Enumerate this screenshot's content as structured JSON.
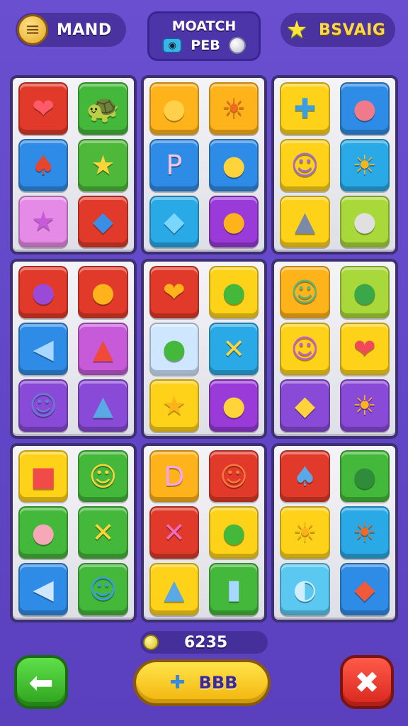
{
  "header": {
    "left": {
      "label": "MAND",
      "icon": "gold-barrel-icon"
    },
    "center": {
      "line1": "MOATCH",
      "line2": "PEB",
      "icons": [
        "gamepad-icon",
        "ball-icon"
      ]
    },
    "right": {
      "label": "BSVAIG",
      "icon": "star-icon"
    }
  },
  "board": {
    "blocks": [
      {
        "tiles": [
          {
            "icon": "heart-icon",
            "glyph": "❤",
            "color": "#e23a2a",
            "fg": "#ff5a6a"
          },
          {
            "icon": "turtle-icon",
            "glyph": "🐢",
            "color": "#43b83a",
            "fg": "#2f7a24"
          },
          {
            "icon": "drumstick-icon",
            "glyph": "♠",
            "color": "#2f8ce6",
            "fg": "#e8452f"
          },
          {
            "icon": "star-icon",
            "glyph": "★",
            "color": "#4db83a",
            "fg": "#ffd43a"
          },
          {
            "icon": "star-icon",
            "glyph": "★",
            "color": "#e58ae6",
            "fg": "#c65ad8"
          },
          {
            "icon": "fish-icon",
            "glyph": "◆",
            "color": "#e23a2a",
            "fg": "#3a8ee6"
          }
        ]
      },
      {
        "tiles": [
          {
            "icon": "bubble-icon",
            "glyph": "●",
            "color": "#ffb31a",
            "fg": "#ffd04a"
          },
          {
            "icon": "sun-icon",
            "glyph": "☀",
            "color": "#ffb31a",
            "fg": "#f06a20"
          },
          {
            "icon": "p-letter-icon",
            "glyph": "P",
            "color": "#2f8ce6",
            "fg": "#f3c6e8"
          },
          {
            "icon": "bird-icon",
            "glyph": "●",
            "color": "#2f8ce6",
            "fg": "#ffd43a"
          },
          {
            "icon": "tag-icon",
            "glyph": "◆",
            "color": "#29a9e6",
            "fg": "#7bd6ff"
          },
          {
            "icon": "balloon-icon",
            "glyph": "●",
            "color": "#9a3ad8",
            "fg": "#ffb31a"
          }
        ]
      },
      {
        "tiles": [
          {
            "icon": "arrow-cross-icon",
            "glyph": "✚",
            "color": "#ffd21a",
            "fg": "#3a9ee6"
          },
          {
            "icon": "speech-bubble-icon",
            "glyph": "●",
            "color": "#2f8ce6",
            "fg": "#f07a8a"
          },
          {
            "icon": "face-icon",
            "glyph": "☺",
            "color": "#ffd21a",
            "fg": "#a06ad8"
          },
          {
            "icon": "sun-face-icon",
            "glyph": "☀",
            "color": "#29a9e6",
            "fg": "#ffb31a"
          },
          {
            "icon": "rocket-icon",
            "glyph": "▲",
            "color": "#ffd21a",
            "fg": "#7a8aa8"
          },
          {
            "icon": "bulb-icon",
            "glyph": "●",
            "color": "#a8d83a",
            "fg": "#e0e0e0"
          }
        ]
      },
      {
        "tiles": [
          {
            "icon": "seal-icon",
            "glyph": "●",
            "color": "#e23a2a",
            "fg": "#9a4ad8"
          },
          {
            "icon": "egg-icon",
            "glyph": "●",
            "color": "#e23a2a",
            "fg": "#ffb31a"
          },
          {
            "icon": "fish-icon",
            "glyph": "◀",
            "color": "#2f8ce6",
            "fg": "#a8d8ff"
          },
          {
            "icon": "cone-icon",
            "glyph": "▲",
            "color": "#c65ad8",
            "fg": "#f04a3a"
          },
          {
            "icon": "cat-icon",
            "glyph": "☺",
            "color": "#8a4ad8",
            "fg": "#6a7ad8"
          },
          {
            "icon": "rocket-icon",
            "glyph": "▲",
            "color": "#8a4ad8",
            "fg": "#5aa8e6"
          }
        ]
      },
      {
        "tiles": [
          {
            "icon": "heart-icon",
            "glyph": "❤",
            "color": "#e23a2a",
            "fg": "#ffb31a"
          },
          {
            "icon": "balloon-icon",
            "glyph": "●",
            "color": "#ffd21a",
            "fg": "#43b83a"
          },
          {
            "icon": "tree-icon",
            "glyph": "●",
            "color": "#cfe6ff",
            "fg": "#43b83a"
          },
          {
            "icon": "x-mark-icon",
            "glyph": "✕",
            "color": "#29a9e6",
            "fg": "#ffd43a"
          },
          {
            "icon": "star-icon",
            "glyph": "★",
            "color": "#ffd21a",
            "fg": "#ffb31a"
          },
          {
            "icon": "balloon-icon",
            "glyph": "●",
            "color": "#9a3ad8",
            "fg": "#ffd43a"
          }
        ]
      },
      {
        "tiles": [
          {
            "icon": "frog-icon",
            "glyph": "☺",
            "color": "#ffb31a",
            "fg": "#5ab87a"
          },
          {
            "icon": "balloon-icon",
            "glyph": "●",
            "color": "#a8d83a",
            "fg": "#3aa84a"
          },
          {
            "icon": "face-icon",
            "glyph": "☺",
            "color": "#ffd21a",
            "fg": "#c65ad8"
          },
          {
            "icon": "heart-icon",
            "glyph": "❤",
            "color": "#ffd21a",
            "fg": "#f04a5a"
          },
          {
            "icon": "bird-icon",
            "glyph": "◆",
            "color": "#8a4ad8",
            "fg": "#ffd43a"
          },
          {
            "icon": "sun-icon",
            "glyph": "☀",
            "color": "#8a4ad8",
            "fg": "#ffb31a"
          }
        ]
      },
      {
        "tiles": [
          {
            "icon": "bag-icon",
            "glyph": "■",
            "color": "#ffd21a",
            "fg": "#f04a4a"
          },
          {
            "icon": "chick-icon",
            "glyph": "☺",
            "color": "#43b83a",
            "fg": "#ffd43a"
          },
          {
            "icon": "pig-icon",
            "glyph": "●",
            "color": "#43b83a",
            "fg": "#f7a8b8"
          },
          {
            "icon": "x-mark-icon",
            "glyph": "✕",
            "color": "#43b83a",
            "fg": "#ffd43a"
          },
          {
            "icon": "fish-icon",
            "glyph": "◀",
            "color": "#2f8ce6",
            "fg": "#cfe6ff"
          },
          {
            "icon": "smiley-icon",
            "glyph": "☺",
            "color": "#43b83a",
            "fg": "#3a9ee6"
          }
        ]
      },
      {
        "tiles": [
          {
            "icon": "d-letter-icon",
            "glyph": "D",
            "color": "#ffb31a",
            "fg": "#f3a6e8"
          },
          {
            "icon": "monster-icon",
            "glyph": "☺",
            "color": "#e23a2a",
            "fg": "#ff7a3a"
          },
          {
            "icon": "x-mark-icon",
            "glyph": "✕",
            "color": "#e23a2a",
            "fg": "#f06ab8"
          },
          {
            "icon": "balloon-icon",
            "glyph": "●",
            "color": "#ffd21a",
            "fg": "#43b83a"
          },
          {
            "icon": "rocket-icon",
            "glyph": "▲",
            "color": "#ffd21a",
            "fg": "#5aa8e6"
          },
          {
            "icon": "clipboard-icon",
            "glyph": "▮",
            "color": "#43b83a",
            "fg": "#a8d8ff"
          }
        ]
      },
      {
        "tiles": [
          {
            "icon": "drumstick-icon",
            "glyph": "♠",
            "color": "#e23a2a",
            "fg": "#5aa8e6"
          },
          {
            "icon": "balloon-icon",
            "glyph": "●",
            "color": "#43b83a",
            "fg": "#2f8c3a"
          },
          {
            "icon": "bug-icon",
            "glyph": "☀",
            "color": "#ffd21a",
            "fg": "#ffb31a"
          },
          {
            "icon": "sun-icon",
            "glyph": "☀",
            "color": "#29a9e6",
            "fg": "#f06a20"
          },
          {
            "icon": "surfboard-icon",
            "glyph": "◐",
            "color": "#5ac8f0",
            "fg": "#cfeeff"
          },
          {
            "icon": "diamond-icon",
            "glyph": "◆",
            "color": "#2f8ce6",
            "fg": "#f05a3a"
          }
        ]
      }
    ]
  },
  "footer": {
    "score": "6235",
    "main_button": {
      "label": "BBB",
      "icon": "gift-figure-icon"
    },
    "back_icon": "back-arrow-icon",
    "quit_icon": "quit-icon"
  }
}
